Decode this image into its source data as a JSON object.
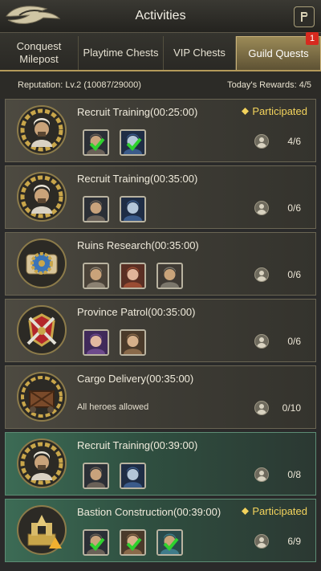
{
  "header": {
    "title": "Activities"
  },
  "tabs": [
    {
      "label": "Conquest\nMilepost"
    },
    {
      "label": "Playtime Chests"
    },
    {
      "label": "VIP Chests"
    },
    {
      "label": "Guild Quests",
      "badge": "1",
      "active": true
    }
  ],
  "info": {
    "reputation": "Reputation: Lv.2 (10087/29000)",
    "rewards": "Today's Rewards: 4/5"
  },
  "quests": [
    {
      "title": "Recruit Training(00:25:00)",
      "status": "Participated",
      "slots": "4/6",
      "emblem": "warrior-bust-emblem",
      "heroes": [
        "hero-portrait-hooded-checked",
        "hero-portrait-masked-checked"
      ],
      "theme": "plain"
    },
    {
      "title": "Recruit Training(00:35:00)",
      "status": "",
      "slots": "0/6",
      "emblem": "warrior-bust-emblem",
      "heroes": [
        "hero-portrait-hooded",
        "hero-portrait-masked"
      ],
      "theme": "plain"
    },
    {
      "title": "Ruins Research(00:35:00)",
      "status": "",
      "slots": "0/6",
      "emblem": "scroll-gear-emblem",
      "heroes": [
        "hero-portrait-armored",
        "hero-portrait-female",
        "hero-portrait-helmet"
      ],
      "theme": "plain"
    },
    {
      "title": "Province Patrol(00:35:00)",
      "status": "",
      "slots": "0/6",
      "emblem": "crossed-swords-emblem",
      "heroes": [
        "hero-portrait-dark-haired",
        "hero-portrait-bearded"
      ],
      "theme": "plain"
    },
    {
      "title": "Cargo Delivery(00:35:00)",
      "status": "",
      "allowed": "All heroes allowed",
      "slots": "0/10",
      "emblem": "cargo-crate-emblem",
      "heroes": [],
      "theme": "plain"
    },
    {
      "title": "Recruit Training(00:39:00)",
      "status": "",
      "slots": "0/8",
      "emblem": "warrior-bust-emblem",
      "heroes": [
        "hero-portrait-hooded",
        "hero-portrait-masked"
      ],
      "theme": "green"
    },
    {
      "title": "Bastion Construction(00:39:00)",
      "status": "Participated",
      "slots": "6/9",
      "emblem": "castle-emblem",
      "heroes": [
        "hero-portrait-hooded-checked",
        "hero-portrait-bearded-checked",
        "hero-portrait-turban-checked"
      ],
      "theme": "green"
    }
  ],
  "colors": {
    "participated": "#f3d35c",
    "badge": "#d72a1f",
    "active_tab": "#9b8a57",
    "green_card": "#3c6b55",
    "check": "#2fd12f"
  }
}
